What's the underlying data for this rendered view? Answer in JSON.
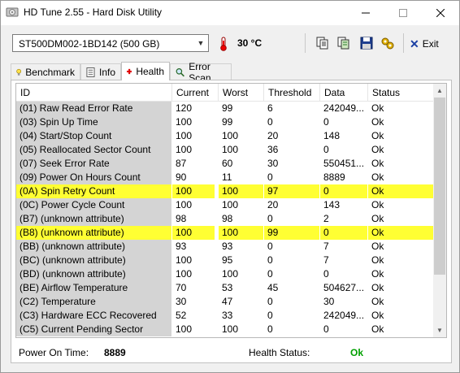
{
  "window": {
    "title": "HD Tune 2.55 - Hard Disk Utility"
  },
  "toolbar": {
    "drive": "ST500DM002-1BD142 (500 GB)",
    "temperature": "30 °C",
    "exit_label": "Exit"
  },
  "tabs": [
    {
      "label": "Benchmark",
      "icon": "lightbulb-icon"
    },
    {
      "label": "Info",
      "icon": "info-icon"
    },
    {
      "label": "Health",
      "icon": "health-cross-icon",
      "active": true
    },
    {
      "label": "Error Scan",
      "icon": "magnifier-icon"
    }
  ],
  "table": {
    "headers": [
      "ID",
      "Current",
      "Worst",
      "Threshold",
      "Data",
      "Status"
    ],
    "rows": [
      {
        "id": "(01) Raw Read Error Rate",
        "current": "120",
        "worst": "99",
        "threshold": "6",
        "data": "242049...",
        "status": "Ok",
        "highlight": false
      },
      {
        "id": "(03) Spin Up Time",
        "current": "100",
        "worst": "99",
        "threshold": "0",
        "data": "0",
        "status": "Ok",
        "highlight": false
      },
      {
        "id": "(04) Start/Stop Count",
        "current": "100",
        "worst": "100",
        "threshold": "20",
        "data": "148",
        "status": "Ok",
        "highlight": false
      },
      {
        "id": "(05) Reallocated Sector Count",
        "current": "100",
        "worst": "100",
        "threshold": "36",
        "data": "0",
        "status": "Ok",
        "highlight": false
      },
      {
        "id": "(07) Seek Error Rate",
        "current": "87",
        "worst": "60",
        "threshold": "30",
        "data": "550451...",
        "status": "Ok",
        "highlight": false
      },
      {
        "id": "(09) Power On Hours Count",
        "current": "90",
        "worst": "11",
        "threshold": "0",
        "data": "8889",
        "status": "Ok",
        "highlight": false
      },
      {
        "id": "(0A) Spin Retry Count",
        "current": "100",
        "worst": "100",
        "threshold": "97",
        "data": "0",
        "status": "Ok",
        "highlight": true
      },
      {
        "id": "(0C) Power Cycle Count",
        "current": "100",
        "worst": "100",
        "threshold": "20",
        "data": "143",
        "status": "Ok",
        "highlight": false
      },
      {
        "id": "(B7) (unknown attribute)",
        "current": "98",
        "worst": "98",
        "threshold": "0",
        "data": "2",
        "status": "Ok",
        "highlight": false
      },
      {
        "id": "(B8) (unknown attribute)",
        "current": "100",
        "worst": "100",
        "threshold": "99",
        "data": "0",
        "status": "Ok",
        "highlight": true
      },
      {
        "id": "(BB) (unknown attribute)",
        "current": "93",
        "worst": "93",
        "threshold": "0",
        "data": "7",
        "status": "Ok",
        "highlight": false
      },
      {
        "id": "(BC) (unknown attribute)",
        "current": "100",
        "worst": "95",
        "threshold": "0",
        "data": "7",
        "status": "Ok",
        "highlight": false
      },
      {
        "id": "(BD) (unknown attribute)",
        "current": "100",
        "worst": "100",
        "threshold": "0",
        "data": "0",
        "status": "Ok",
        "highlight": false
      },
      {
        "id": "(BE) Airflow Temperature",
        "current": "70",
        "worst": "53",
        "threshold": "45",
        "data": "504627...",
        "status": "Ok",
        "highlight": false
      },
      {
        "id": "(C2) Temperature",
        "current": "30",
        "worst": "47",
        "threshold": "0",
        "data": "30",
        "status": "Ok",
        "highlight": false
      },
      {
        "id": "(C3) Hardware ECC Recovered",
        "current": "52",
        "worst": "33",
        "threshold": "0",
        "data": "242049...",
        "status": "Ok",
        "highlight": false
      },
      {
        "id": "(C5) Current Pending Sector",
        "current": "100",
        "worst": "100",
        "threshold": "0",
        "data": "0",
        "status": "Ok",
        "highlight": false
      }
    ]
  },
  "footer": {
    "power_on_label": "Power On Time:",
    "power_on_value": "8889",
    "health_label": "Health Status:",
    "health_value": "Ok"
  },
  "colors": {
    "highlight": "#ffff33",
    "ok_green": "#00a000",
    "exit_blue": "#1a3fa3"
  }
}
